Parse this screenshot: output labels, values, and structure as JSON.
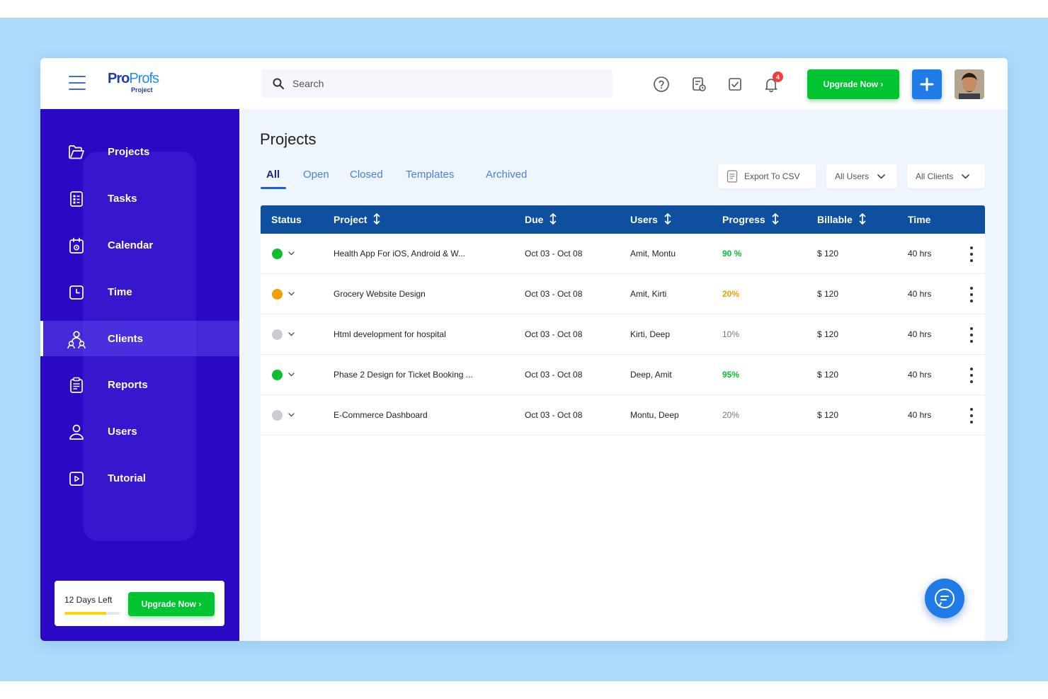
{
  "colors": {
    "sidebar": "#2a08c4",
    "accent_green": "#00c531",
    "accent_blue": "#1f7be6",
    "table_header": "#0e4f9f",
    "progress_high": "#00c531",
    "progress_mid": "#f29c00",
    "progress_low": "#777777",
    "status_green": "#0fbf2f",
    "status_orange": "#f0a000",
    "status_gray": "#c9ccd3"
  },
  "header": {
    "logo_brand": "Pro",
    "logo_brand_accent": "Profs",
    "logo_product": "Project",
    "search_placeholder": "Search",
    "icons": [
      "help-icon",
      "timesheet-icon",
      "checklist-icon",
      "bell-icon"
    ],
    "notification_count": "4",
    "upgrade_label": "Upgrade Now ›",
    "add_icon": "plus-icon"
  },
  "sidebar": {
    "items": [
      {
        "label": "Projects",
        "icon": "folder-icon"
      },
      {
        "label": "Tasks",
        "icon": "tasks-icon"
      },
      {
        "label": "Calendar",
        "icon": "calendar-icon"
      },
      {
        "label": "Time",
        "icon": "clock-icon"
      },
      {
        "label": "Clients",
        "icon": "clients-icon",
        "active": true
      },
      {
        "label": "Reports",
        "icon": "reports-icon"
      },
      {
        "label": "Users",
        "icon": "user-icon"
      },
      {
        "label": "Tutorial",
        "icon": "play-icon"
      }
    ],
    "trial": {
      "text": "12 Days Left",
      "progress": 0.75,
      "upgrade_label": "Upgrade Now ›"
    }
  },
  "main": {
    "title": "Projects",
    "tabs": [
      {
        "label": "All",
        "active": true
      },
      {
        "label": "Open"
      },
      {
        "label": "Closed"
      },
      {
        "label": "Templates"
      },
      {
        "label": "Archived"
      }
    ],
    "export_label": "Export To CSV",
    "filters": {
      "users": "All Users",
      "clients": "All Clients"
    },
    "table": {
      "columns": [
        "Status",
        "Project",
        "Due",
        "Users",
        "Progress",
        "Billable",
        "Time"
      ],
      "sortable": [
        false,
        true,
        true,
        true,
        true,
        true,
        false
      ],
      "rows": [
        {
          "status": "green",
          "project": "Health App For iOS, Android & W...",
          "due": "Oct 03 - Oct 08",
          "users": "Amit, Montu",
          "progress": "90 %",
          "progress_level": "high",
          "billable": "$ 120",
          "time": "40 hrs"
        },
        {
          "status": "orange",
          "project": "Grocery Website Design",
          "due": "Oct 03 - Oct 08",
          "users": "Amit, Kirti",
          "progress": "20%",
          "progress_level": "mid",
          "billable": "$ 120",
          "time": "40 hrs"
        },
        {
          "status": "gray",
          "project": "Html development for hospital",
          "due": "Oct 03 - Oct 08",
          "users": "Kirti, Deep",
          "progress": "10%",
          "progress_level": "low",
          "billable": "$ 120",
          "time": "40 hrs"
        },
        {
          "status": "green",
          "project": "Phase 2 Design for Ticket Booking ...",
          "due": "Oct 03 - Oct 08",
          "users": "Deep, Amit",
          "progress": "95%",
          "progress_level": "high",
          "billable": "$ 120",
          "time": "40 hrs"
        },
        {
          "status": "gray",
          "project": "E-Commerce Dashboard",
          "due": "Oct 03 - Oct 08",
          "users": "Montu, Deep",
          "progress": "20%",
          "progress_level": "low",
          "billable": "$ 120",
          "time": "40 hrs"
        }
      ]
    },
    "chat_icon": "chat-icon"
  }
}
